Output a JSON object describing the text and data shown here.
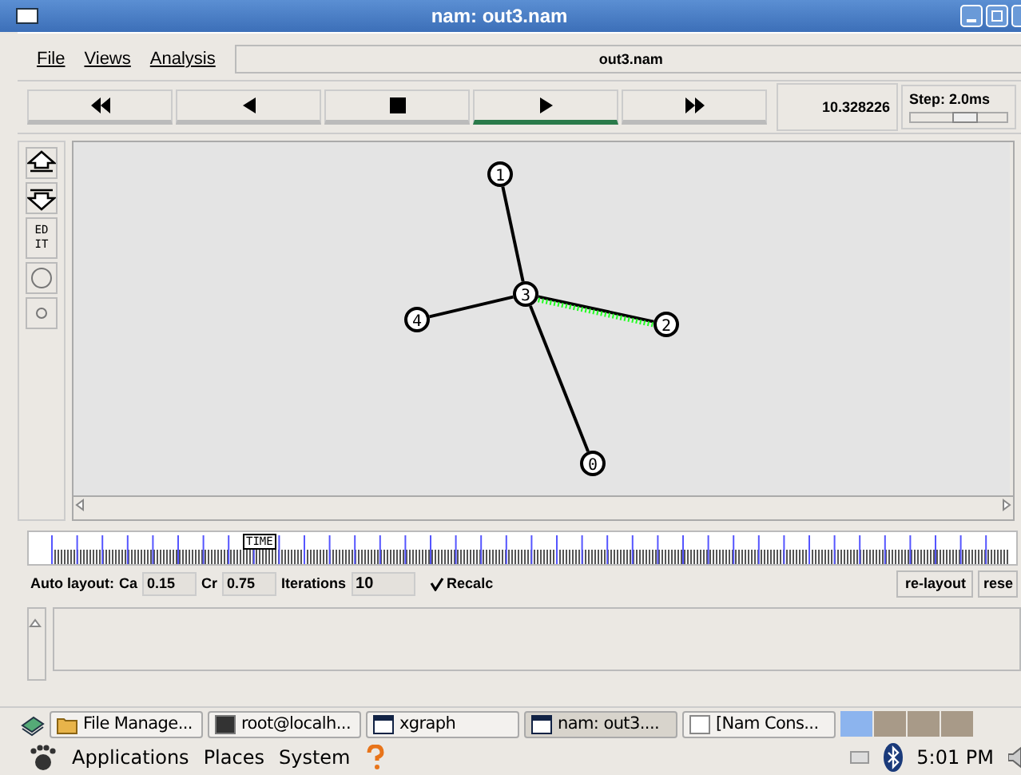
{
  "window": {
    "title": "nam: out3.nam"
  },
  "menu": [
    {
      "label": "File"
    },
    {
      "label": "Views"
    },
    {
      "label": "Analysis"
    }
  ],
  "file_label": "out3.nam",
  "controls": [
    {
      "kind": "rewind",
      "selected": false
    },
    {
      "kind": "back",
      "selected": false
    },
    {
      "kind": "stop",
      "selected": false
    },
    {
      "kind": "play",
      "selected": true
    },
    {
      "kind": "forward",
      "selected": false
    }
  ],
  "time": "10.328226",
  "step": {
    "label": "Step: 2.0ms",
    "level": 0.6
  },
  "tools": [
    {
      "kind": "up"
    },
    {
      "kind": "down"
    },
    {
      "kind": "edit",
      "lines": [
        "ED",
        "IT"
      ]
    },
    {
      "kind": "big-circle"
    },
    {
      "kind": "small-circle"
    }
  ],
  "nodes": [
    {
      "label": "1"
    },
    {
      "label": "3"
    },
    {
      "label": "4"
    },
    {
      "label": "2"
    },
    {
      "label": "0"
    }
  ],
  "links": [
    {
      "packets": false
    },
    {
      "packets": false
    },
    {
      "packets": true
    },
    {
      "packets": false
    }
  ],
  "timeline": {
    "marker": "TIME",
    "level": 0.2
  },
  "auto_layout": {
    "label": "Auto layout:",
    "fields": [
      {
        "label": "Ca",
        "value": "0.15"
      },
      {
        "label": "Cr",
        "value": "0.75"
      },
      {
        "label": "Iterations",
        "value": "10"
      }
    ],
    "recalc": {
      "label": "Recalc",
      "checked": true
    },
    "buttons": [
      "re-layout",
      "rese"
    ]
  },
  "taskbar": {
    "items": [
      {
        "kind": "folder",
        "label": "File Manage...",
        "selected": false
      },
      {
        "kind": "terminal",
        "label": "root@localh...",
        "selected": false
      },
      {
        "kind": "window",
        "label": "xgraph",
        "selected": false
      },
      {
        "kind": "window",
        "label": "nam: out3....",
        "selected": true
      },
      {
        "kind": "blank",
        "label": "[Nam Cons...",
        "selected": false
      }
    ],
    "workspaces": [
      {
        "selected": true
      },
      {
        "selected": false
      },
      {
        "selected": false
      },
      {
        "selected": false
      }
    ]
  },
  "panel": {
    "menus": [
      "Applications",
      "Places",
      "System"
    ],
    "clock": "5:01 PM"
  }
}
